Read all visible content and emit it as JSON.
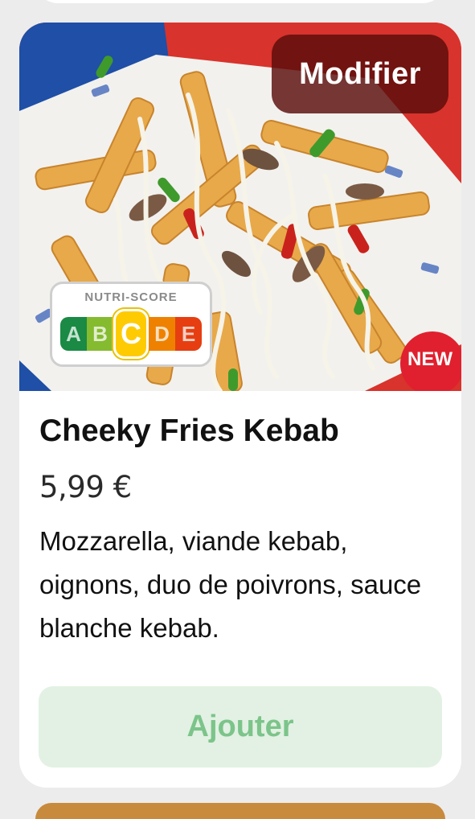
{
  "product": {
    "image_alt": "Cheeky Fries Kebab",
    "modify_label": "Modifier",
    "nutri_score": {
      "label": "NUTRI-SCORE",
      "grades": [
        "A",
        "B",
        "C",
        "D",
        "E"
      ],
      "grade_colors": [
        "#1a8a44",
        "#85bb2f",
        "#fecb02",
        "#ee8100",
        "#e63e11"
      ],
      "selected": "C"
    },
    "badge": "NEW",
    "name": "Cheeky Fries Kebab",
    "price": "5,99 €",
    "description": "Mozzarella, viande kebab, oignons, duo de poivrons, sauce blanche kebab.",
    "add_label": "Ajouter"
  },
  "colors": {
    "add_button_bg": "#e2f1e3",
    "add_button_text": "#7cc48a",
    "badge": "#e0202e"
  }
}
